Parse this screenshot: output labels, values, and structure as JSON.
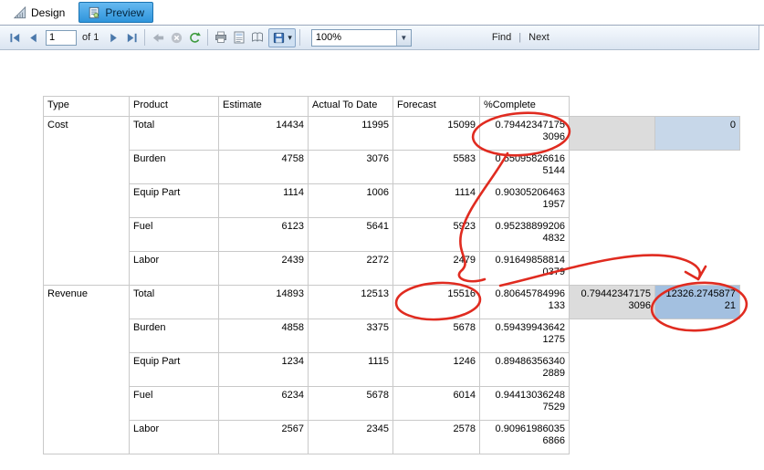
{
  "tabs": {
    "design": "Design",
    "preview": "Preview"
  },
  "toolbar": {
    "page_value": "1",
    "of_label": "of 1",
    "zoom_value": "100%",
    "find_label": "Find",
    "find_sep": "|",
    "next_label": "Next"
  },
  "icons": [
    "first-page-icon",
    "previous-page-icon",
    "next-page-icon",
    "last-page-icon",
    "back-icon",
    "stop-icon",
    "refresh-icon",
    "print-icon",
    "print-layout-icon",
    "page-setup-icon",
    "export-save-icon",
    "dropdown-caret-icon",
    "zoom-dropdown-icon",
    "design-tab-icon",
    "preview-tab-icon"
  ],
  "colors": {
    "selected_tab_blue": "#2f95dc",
    "group_cell_gray": "#dcdcdc",
    "highlight_blue_light": "#c7d7e9",
    "highlight_blue": "#a3c0e0",
    "annotation_red": "#e02b20",
    "table_border": "#c9c9c9"
  },
  "table": {
    "headers": {
      "type": "Type",
      "product": "Product",
      "estimate": "Estimate",
      "actual": "Actual To Date",
      "forecast": "Forecast",
      "pct": "%Complete"
    },
    "groups": [
      {
        "type": "Cost"
      },
      {
        "type": "Revenue"
      }
    ],
    "rows": [
      {
        "product": "Total",
        "estimate": "14434",
        "actual": "11995",
        "forecast": "15099",
        "pct": "0.79442347175\n3096",
        "extra1": "",
        "extra2": "0"
      },
      {
        "product": "Burden",
        "estimate": "4758",
        "actual": "3076",
        "forecast": "5583",
        "pct": "0.55095826616\n5144"
      },
      {
        "product": "Equip Part",
        "estimate": "1114",
        "actual": "1006",
        "forecast": "1114",
        "pct": "0.90305206463\n1957"
      },
      {
        "product": "Fuel",
        "estimate": "6123",
        "actual": "5641",
        "forecast": "5923",
        "pct": "0.95238899206\n4832"
      },
      {
        "product": "Labor",
        "estimate": "2439",
        "actual": "2272",
        "forecast": "2479",
        "pct": "0.91649858814\n0379"
      },
      {
        "product": "Total",
        "estimate": "14893",
        "actual": "12513",
        "forecast": "15516",
        "pct": "0.80645784996\n133",
        "extra1": "0.79442347175\n3096",
        "extra2": "12326.2745877\n21"
      },
      {
        "product": "Burden",
        "estimate": "4858",
        "actual": "3375",
        "forecast": "5678",
        "pct": "0.59439943642\n1275"
      },
      {
        "product": "Equip Part",
        "estimate": "1234",
        "actual": "1115",
        "forecast": "1246",
        "pct": "0.89486356340\n2889"
      },
      {
        "product": "Fuel",
        "estimate": "6234",
        "actual": "5678",
        "forecast": "6014",
        "pct": "0.94413036248\n7529"
      },
      {
        "product": "Labor",
        "estimate": "2567",
        "actual": "2345",
        "forecast": "2578",
        "pct": "0.90961986035\n6866"
      }
    ]
  }
}
